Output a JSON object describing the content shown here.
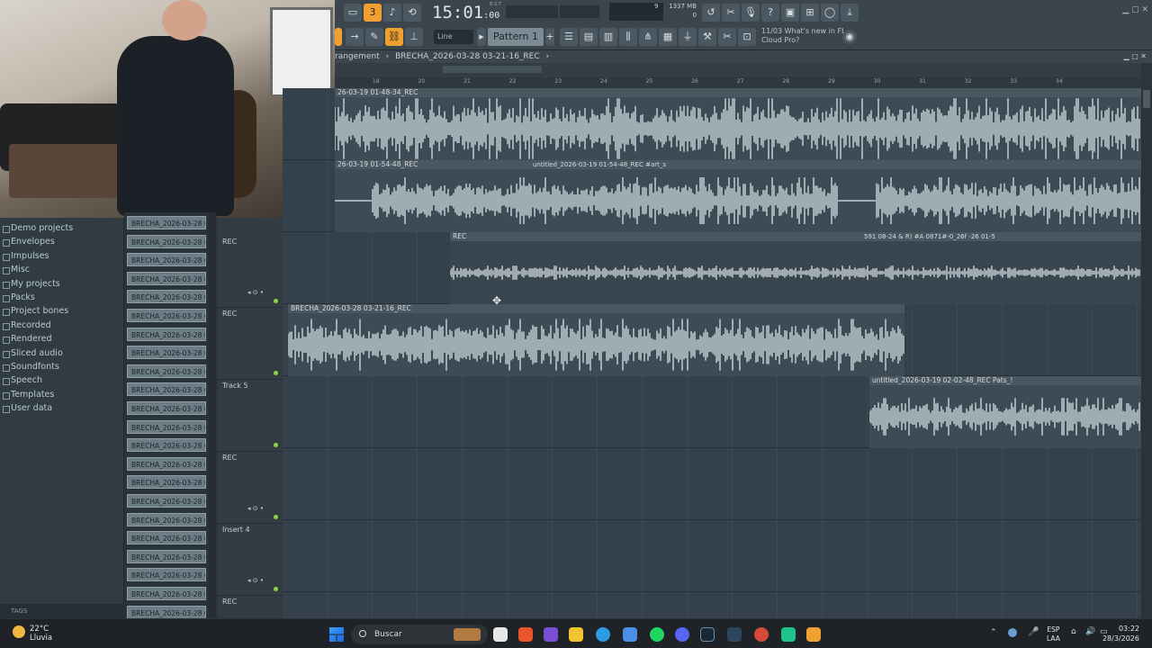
{
  "toolbar": {
    "time": "15:01",
    "time_frac": ":00",
    "time_label": "B:S:T",
    "cpu_value": "9",
    "memory": "1337 MB",
    "polyphony": "0",
    "snap": "Line",
    "pattern": "Pattern 1",
    "news_date": "11/03",
    "news_title": "What's new in FL",
    "news_sub": "Cloud Pro?"
  },
  "breadcrumb": {
    "prefix": "rangement",
    "separator": "›",
    "current": "BRECHA_2026-03-28 03-21-16_REC",
    "suffix": "›"
  },
  "ruler": {
    "ticks": [
      "18",
      "20",
      "21",
      "22",
      "23",
      "24",
      "25",
      "26",
      "27",
      "28",
      "29",
      "30",
      "31",
      "32",
      "33",
      "34"
    ]
  },
  "browser": {
    "items": [
      {
        "label": "Demo projects",
        "icon": "folder-icon"
      },
      {
        "label": "Envelopes",
        "icon": "folder-icon"
      },
      {
        "label": "Impulses",
        "icon": "folder-icon"
      },
      {
        "label": "Misc",
        "icon": "folder-icon"
      },
      {
        "label": "My projects",
        "icon": "folder-icon"
      },
      {
        "label": "Packs",
        "icon": "folder-icon"
      },
      {
        "label": "Project bones",
        "icon": "folder-icon"
      },
      {
        "label": "Recorded",
        "icon": "folder-icon"
      },
      {
        "label": "Rendered",
        "icon": "folder-icon"
      },
      {
        "label": "Sliced audio",
        "icon": "folder-icon"
      },
      {
        "label": "Soundfonts",
        "icon": "folder-icon"
      },
      {
        "label": "Speech",
        "icon": "folder-icon"
      },
      {
        "label": "Templates",
        "icon": "folder-icon"
      },
      {
        "label": "User data",
        "icon": "user-icon"
      }
    ],
    "tags_label": "TAGS"
  },
  "files": [
    "BRECHA_2026-03-28 01-",
    "BRECHA_2026-03-28 01-",
    "BRECHA_2026-03-28 01-",
    "BRECHA_2026-03-28 02-",
    "BRECHA_2026-03-28 02-",
    "BRECHA_2026-03-28 02-",
    "BRECHA_2026-03-28 02-",
    "BRECHA_2026-03-28 02-",
    "BRECHA_2026-03-28 02-",
    "BRECHA_2026-03-28 02-",
    "BRECHA_2026-03-28 02-",
    "BRECHA_2026-03-28 02-",
    "BRECHA_2026-03-28 02-",
    "BRECHA_2026-03-28 03-",
    "BRECHA_2026-03-28 03-",
    "BRECHA_2026-03-28 03-",
    "BRECHA_2026-03-28 03-",
    "BRECHA_2026-03-28 03-",
    "BRECHA_2026-03-28 03-",
    "BRECHA_2026-03-28 03-",
    "BRECHA_2026-03-28 03-",
    "BRECHA_2026-03-28 03-"
  ],
  "tracks": [
    {
      "name": "REC",
      "has_controls": true
    },
    {
      "name": "REC",
      "has_controls": false
    },
    {
      "name": "Track 5",
      "has_controls": false
    },
    {
      "name": "REC",
      "has_controls": true
    },
    {
      "name": "Insert 4",
      "has_controls": true
    },
    {
      "name": "REC",
      "has_controls": false
    }
  ],
  "clips": {
    "c1": "26-03-19 01-48-34_REC",
    "c2": "26-03-19 01-54-48_REC",
    "c2b": "untitled_2026-03-19 01-54-48_REC #art_s",
    "c3": "REC",
    "c3b": "591 08-24 & R) #A 0871#-0_26f -26 01-5",
    "c4": "BRECHA_2026-03-28 03-21-16_REC",
    "c5": "untitled_2026-03-19 02-02-48_REC Pats_!"
  },
  "taskbar": {
    "temperature": "22°C",
    "weather": "Lluvia",
    "search": "Buscar",
    "lang1": "ESP",
    "lang2": "LAA",
    "time": "03:22",
    "date": "28/3/2026"
  },
  "colors": {
    "accent": "#f0a030",
    "wave": "#c7d2d8",
    "panel": "#34414a"
  }
}
